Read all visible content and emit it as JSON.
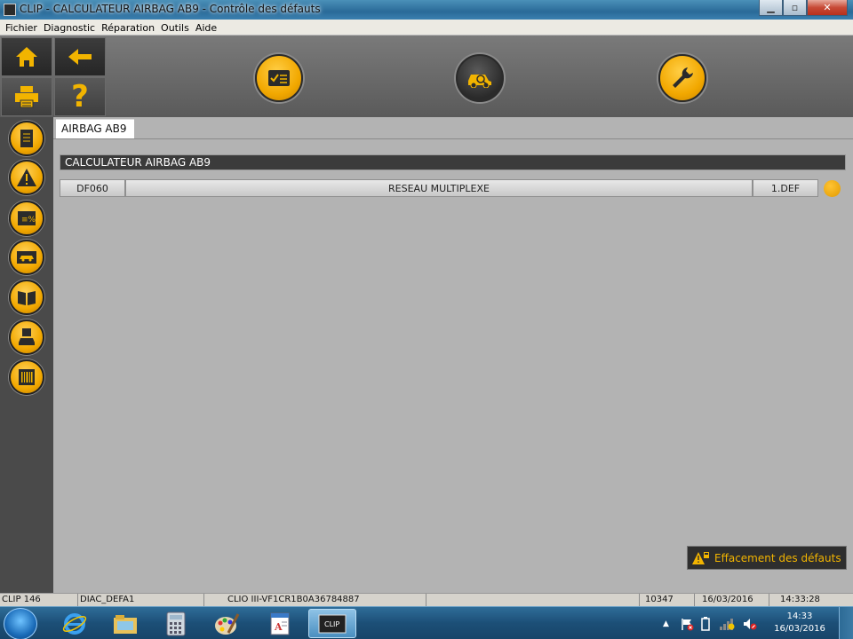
{
  "window": {
    "title": "CLIP - CALCULATEUR AIRBAG AB9 - Contrôle des défauts",
    "controls": {
      "minimize": "▁",
      "maximize": "▫",
      "close": "✕"
    }
  },
  "menu": {
    "items": [
      "Fichier",
      "Diagnostic",
      "Réparation",
      "Outils",
      "Aide"
    ]
  },
  "toolbar": {
    "left_buttons": [
      "home-icon",
      "back-arrow-icon",
      "printer-icon",
      "help-icon"
    ],
    "help_label": "?",
    "center_buttons": [
      "checklist-icon",
      "vehicle-diagnosis-icon",
      "wrench-icon"
    ]
  },
  "sidebar": {
    "items": [
      "document-icon",
      "warning-icon",
      "parameters-icon",
      "vehicle-config-icon",
      "manual-book-icon",
      "save-vehicle-icon",
      "barcode-icon"
    ]
  },
  "main": {
    "tab_label": "AIRBAG AB9",
    "module_title": "CALCULATEUR AIRBAG AB9",
    "faults": [
      {
        "code": "DF060",
        "description": "RESEAU MULTIPLEXE",
        "status": "1.DEF",
        "status_color": "#F2A800"
      }
    ],
    "clear_button_label": "Effacement des défauts"
  },
  "statusbar": {
    "cells": [
      "CLIP 146",
      "DIAC_DEFA1",
      "CLIO III-VF1CR1B0A36784887",
      "",
      "10347",
      "16/03/2016",
      "14:33:28"
    ]
  },
  "taskbar": {
    "apps": [
      "internet-explorer-icon",
      "file-explorer-icon",
      "calculator-icon",
      "paint-icon",
      "wordpad-icon",
      "clip-app-icon"
    ],
    "clip_label": "CLIP",
    "clock_time": "14:33",
    "clock_date": "16/03/2016"
  },
  "colors": {
    "accent": "#F2A800",
    "toolbar_bg": "#666666",
    "content_bg": "#B3B3B3",
    "header_bg": "#3B3B3B"
  }
}
